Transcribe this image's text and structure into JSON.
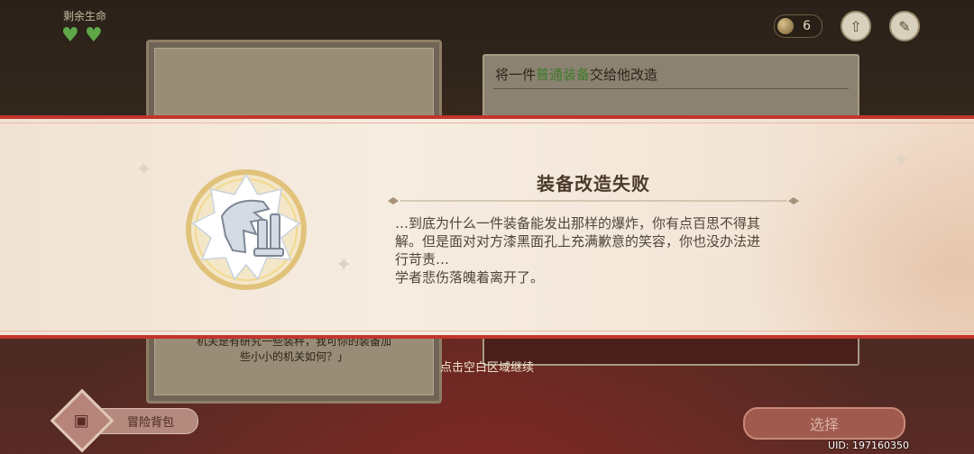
{
  "hud": {
    "lives_label": "剩余生命",
    "hearts_remaining": 2,
    "coin_count": "6"
  },
  "background": {
    "task_title_prefix": "将一件",
    "task_title_highlight": "普通装备",
    "task_title_suffix": "交给他改造",
    "left_card_text_line1": "机关是有研究一些装秤，我可你的装备加",
    "left_card_text_line2": "些小小的机关如何？」",
    "bag_label": "冒险背包",
    "choose_label": "选择"
  },
  "banner": {
    "title": "装备改造失败",
    "body_lines": [
      "…到底为什么一件装备能发出那样的爆炸，你有点百思不得其",
      "解。但是面对对方漆黑面孔上充满歉意的笑容，你也没办法进",
      "行苛责…",
      "学者悲伤落魄着离开了。"
    ]
  },
  "continue_hint": "点击空白区域继续",
  "uid": "UID: 197160350",
  "colors": {
    "banner_border": "#c2352c",
    "heart": "#5fa84a",
    "highlight": "#3f7b2a"
  }
}
